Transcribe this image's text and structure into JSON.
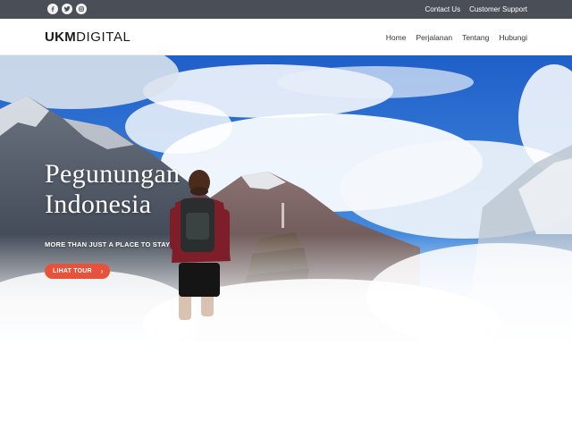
{
  "topbar": {
    "social": [
      "facebook-icon",
      "twitter-icon",
      "instagram-icon"
    ],
    "links": [
      "Contact Us",
      "Customer Support"
    ]
  },
  "header": {
    "logo_bold": "UKM",
    "logo_light": "DIGITAL",
    "nav": [
      "Home",
      "Perjalanan",
      "Tentang",
      "Hubungi"
    ]
  },
  "hero": {
    "title_line1": "Pegunungan",
    "title_line2": "Indonesia",
    "subtitle": "MORE THAN JUST A PLACE TO STAY",
    "button_label": "LIHAT TOUR",
    "button_icon": "chevron-right-icon"
  },
  "colors": {
    "topbar": "#4a4f57",
    "accent": "#e8523a",
    "sky": "#2f6fd0"
  }
}
